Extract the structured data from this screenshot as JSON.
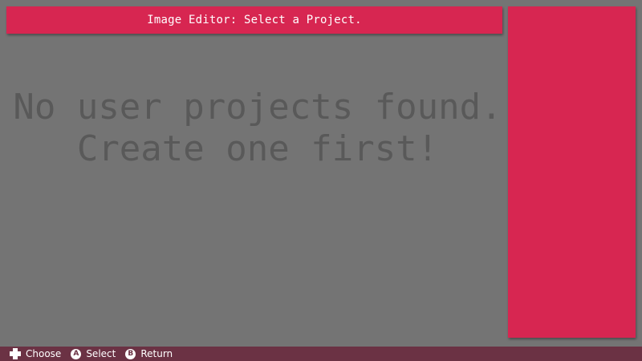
{
  "header": {
    "title": "Image Editor: Select a Project."
  },
  "main": {
    "message_line1": "No user projects found.",
    "message_line2": "Create one first!"
  },
  "footer": {
    "hints": [
      {
        "icon": "dpad-icon",
        "label": "Choose"
      },
      {
        "icon": "a-button-icon",
        "glyph": "A",
        "label": "Select"
      },
      {
        "icon": "b-button-icon",
        "glyph": "B",
        "label": "Return"
      }
    ]
  },
  "colors": {
    "background": "#747474",
    "accent": "#d72651",
    "footer": "#6b3244",
    "message_text": "#595959"
  }
}
